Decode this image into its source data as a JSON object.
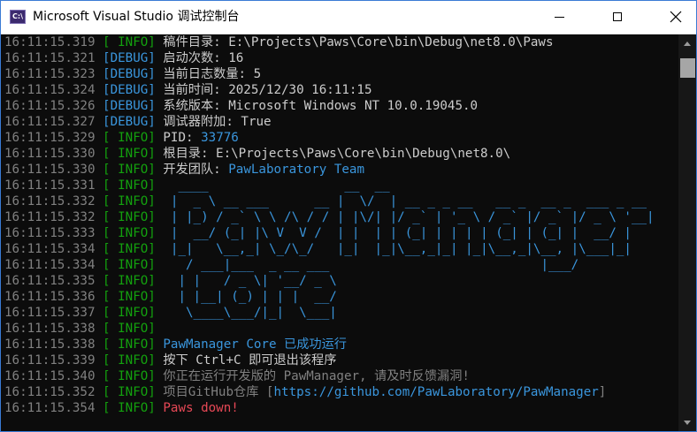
{
  "window": {
    "title": "Microsoft Visual Studio 调试控制台",
    "icon_text": "C:\\"
  },
  "icons": {
    "app": "console-app-icon",
    "minimize": "minimize-icon",
    "maximize": "maximize-icon",
    "close": "close-icon"
  },
  "colors": {
    "info": "#13a10e",
    "debug": "#3a96dd",
    "text": "#cccccc",
    "accent": "#3a96dd",
    "error": "#e74856",
    "timestamp": "#808080"
  },
  "lines": [
    {
      "ts": "16:11:15.319",
      "level": "[ INFO]",
      "lvl": "info",
      "msg": "稿件目录: E:\\Projects\\Paws\\Core\\bin\\Debug\\net8.0\\Paws",
      "msg_class": "msg"
    },
    {
      "ts": "16:11:15.321",
      "level": "[DEBUG]",
      "lvl": "debug",
      "msg": "启动次数: 16",
      "msg_class": "msg"
    },
    {
      "ts": "16:11:15.323",
      "level": "[DEBUG]",
      "lvl": "debug",
      "msg": "当前日志数量: 5",
      "msg_class": "msg"
    },
    {
      "ts": "16:11:15.324",
      "level": "[DEBUG]",
      "lvl": "debug",
      "msg": "当前时间: 2025/12/30 16:11:15",
      "msg_class": "msg"
    },
    {
      "ts": "16:11:15.326",
      "level": "[DEBUG]",
      "lvl": "debug",
      "msg": "系统版本: Microsoft Windows NT 10.0.19045.0",
      "msg_class": "msg"
    },
    {
      "ts": "16:11:15.327",
      "level": "[DEBUG]",
      "lvl": "debug",
      "msg": "调试器附加: True",
      "msg_class": "msg"
    },
    {
      "ts": "16:11:15.329",
      "level": "[ INFO]",
      "lvl": "info",
      "msg_parts": [
        {
          "t": "PID: ",
          "c": "msg"
        },
        {
          "t": "33776",
          "c": "cyan"
        }
      ]
    },
    {
      "ts": "16:11:15.330",
      "level": "[ INFO]",
      "lvl": "info",
      "msg": "根目录: E:\\Projects\\Paws\\Core\\bin\\Debug\\net8.0\\",
      "msg_class": "msg"
    },
    {
      "ts": "16:11:15.330",
      "level": "[ INFO]",
      "lvl": "info",
      "msg_parts": [
        {
          "t": "开发团队: ",
          "c": "msg"
        },
        {
          "t": "PawLaboratory Team",
          "c": "cyan"
        }
      ]
    },
    {
      "ts": "16:11:15.331",
      "level": "[ INFO]",
      "lvl": "info",
      "msg": "  ____                  __  __",
      "msg_class": "banner"
    },
    {
      "ts": "16:11:15.332",
      "level": "[ INFO]",
      "lvl": "info",
      "msg": " |  _ \\ __ ___      __ |  \\/  | __ _ _ __   __ _  __ _  ___ _ __",
      "msg_class": "banner"
    },
    {
      "ts": "16:11:15.332",
      "level": "[ INFO]",
      "lvl": "info",
      "msg": " | |_) / _` \\ \\ /\\ / / | |\\/| |/ _` | '_ \\ / _` |/ _` |/ _ \\ '__|",
      "msg_class": "banner"
    },
    {
      "ts": "16:11:15.333",
      "level": "[ INFO]",
      "lvl": "info",
      "msg": " |  __/ (_| |\\ V  V /  | |  | | (_| | | | | (_| | (_| |  __/ |",
      "msg_class": "banner"
    },
    {
      "ts": "16:11:15.334",
      "level": "[ INFO]",
      "lvl": "info",
      "msg": " |_|   \\__,_| \\_/\\_/   |_|  |_|\\__,_|_| |_|\\__,_|\\__, |\\___|_|",
      "msg_class": "banner"
    },
    {
      "ts": "16:11:15.334",
      "level": "[ INFO]",
      "lvl": "info",
      "msg": "   / ___|___  _ __ ___                            |___/",
      "msg_class": "banner"
    },
    {
      "ts": "16:11:15.335",
      "level": "[ INFO]",
      "lvl": "info",
      "msg": "  | |   / _ \\| '__/ _ \\",
      "msg_class": "banner"
    },
    {
      "ts": "16:11:15.336",
      "level": "[ INFO]",
      "lvl": "info",
      "msg": "  | |__| (_) | | |  __/",
      "msg_class": "banner"
    },
    {
      "ts": "16:11:15.337",
      "level": "[ INFO]",
      "lvl": "info",
      "msg": "   \\____\\___/|_|  \\___|",
      "msg_class": "banner"
    },
    {
      "ts": "16:11:15.338",
      "level": "[ INFO]",
      "lvl": "info",
      "msg": "",
      "msg_class": "msg"
    },
    {
      "ts": "16:11:15.338",
      "level": "[ INFO]",
      "lvl": "info",
      "msg": "PawManager Core 已成功运行",
      "msg_class": "cyan"
    },
    {
      "ts": "16:11:15.339",
      "level": "[ INFO]",
      "lvl": "info",
      "msg": "按下 Ctrl+C 即可退出该程序",
      "msg_class": "msg"
    },
    {
      "ts": "16:11:15.340",
      "level": "[ INFO]",
      "lvl": "info",
      "msg": "你正在运行开发版的 PawManager, 请及时反馈漏洞!",
      "msg_class": "dim"
    },
    {
      "ts": "16:11:15.352",
      "level": "[ INFO]",
      "lvl": "info",
      "msg_parts": [
        {
          "t": "项目GitHub仓库 [",
          "c": "dim"
        },
        {
          "t": "https://github.com/PawLaboratory/PawManager",
          "c": "cyan"
        },
        {
          "t": "]",
          "c": "dim"
        }
      ]
    },
    {
      "ts": "16:11:15.354",
      "level": "[ INFO]",
      "lvl": "info",
      "msg": "Paws down!",
      "msg_class": "red"
    }
  ]
}
